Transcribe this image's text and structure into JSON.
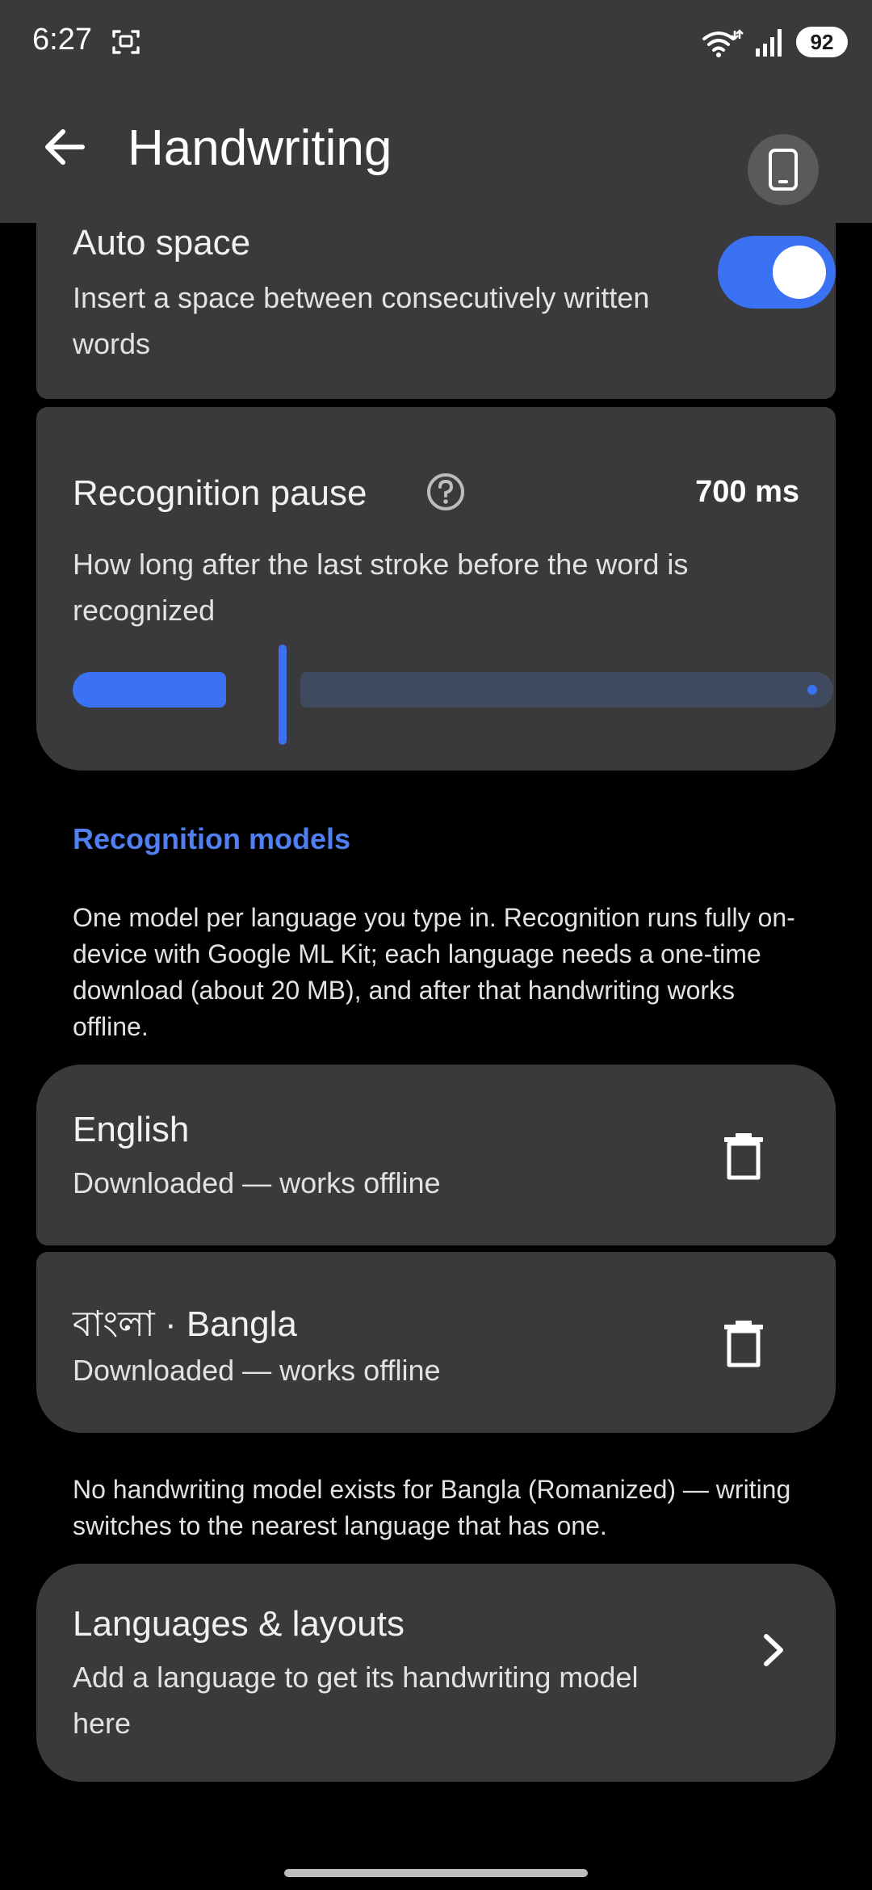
{
  "status_bar": {
    "time": "6:27",
    "battery": "92",
    "icons": [
      "screenshot-icon",
      "wifi-icon",
      "signal-icon",
      "battery-icon"
    ]
  },
  "app_bar": {
    "title": "Handwriting",
    "back_icon": "arrow-back-icon",
    "device_icon": "phone-icon"
  },
  "auto_space": {
    "title": "Auto space",
    "description": "Insert a space between consecutively written words",
    "enabled": true
  },
  "recognition_pause": {
    "title": "Recognition pause",
    "value": "700 ms",
    "description": "How long after the last stroke before the word is recognized",
    "help_icon": "help-circle-icon"
  },
  "recognition_models": {
    "header": "Recognition models",
    "description": "One model per language you type in. Recognition runs fully on-device with Google ML Kit; each language needs a one-time download (about 20 MB), and after that handwriting works offline.",
    "models": [
      {
        "name": "English",
        "status": "Downloaded — works offline",
        "action_icon": "delete-icon"
      },
      {
        "name": "বাংলা · Bangla",
        "status": "Downloaded — works offline",
        "action_icon": "delete-icon"
      }
    ],
    "note": "No handwriting model exists for Bangla (Romanized) — writing switches to the nearest language that has one."
  },
  "languages_layouts": {
    "title": "Languages & layouts",
    "description": "Add a language to get its handwriting model here",
    "chevron_icon": "chevron-right-icon"
  },
  "colors": {
    "accent": "#3b72f4",
    "header_text": "#4f7ff0",
    "card_bg": "#3a3a3c",
    "background": "#000000"
  }
}
